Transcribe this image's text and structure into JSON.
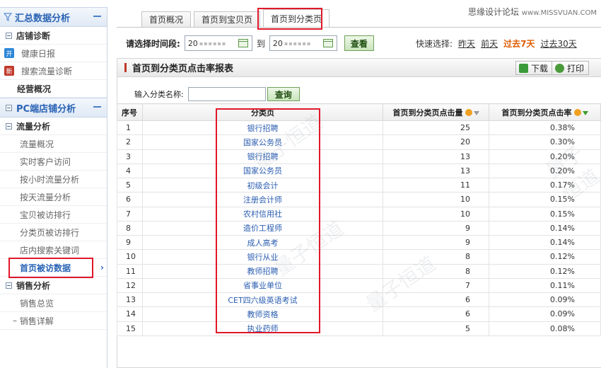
{
  "site_watermark": {
    "cn": "思缘设计论坛",
    "en": "www.MISSVUAN.COM"
  },
  "sidebar": {
    "sections": [
      {
        "title": "汇总数据分析"
      },
      {
        "title": "PC端店铺分析"
      }
    ],
    "summary_groups": [
      {
        "label": "店铺诊断",
        "items": [
          {
            "label": "健康日报",
            "badge": "开",
            "badge_color": "#2d86d8"
          },
          {
            "label": "搜索流量诊断",
            "badge": "新",
            "badge_color": "#c0392b"
          }
        ]
      },
      {
        "label": "经营概况"
      }
    ],
    "pc_groups": [
      {
        "label": "流量分析",
        "items": [
          {
            "label": "流量概况"
          },
          {
            "label": "实时客户访问"
          },
          {
            "label": "按小时流量分析"
          },
          {
            "label": "按天流量分析"
          },
          {
            "label": "宝贝被访排行"
          },
          {
            "label": "分类页被访排行"
          },
          {
            "label": "店内搜索关键词"
          },
          {
            "label": "首页被访数据",
            "active": true
          }
        ]
      },
      {
        "label": "销售分析",
        "items": [
          {
            "label": "销售总览"
          },
          {
            "label": "销售详解"
          }
        ]
      }
    ]
  },
  "tabs": [
    {
      "label": "首页概况"
    },
    {
      "label": "首页到宝贝页"
    },
    {
      "label": "首页到分类页",
      "active": true
    }
  ],
  "date_filter": {
    "label": "请选择时间段:",
    "start_prefix": "20",
    "end_prefix": "20",
    "to_label": "到",
    "query_button": "查看",
    "quick_label": "快速选择:",
    "quick_options": [
      {
        "label": "昨天"
      },
      {
        "label": "前天"
      },
      {
        "label": "过去7天",
        "current": true
      },
      {
        "label": "过去30天"
      }
    ]
  },
  "report": {
    "title": "首页到分类页点击率报表",
    "download_label": "下载",
    "print_label": "打印",
    "search_label": "输入分类名称:",
    "search_button": "查询",
    "columns": [
      "序号",
      "分类页",
      "首页到分类页点击量",
      "首页到分类页点击率"
    ],
    "rows": [
      {
        "no": "1",
        "name": "银行招聘",
        "clicks": "25",
        "rate": "0.38%"
      },
      {
        "no": "2",
        "name": "国家公务员",
        "clicks": "20",
        "rate": "0.30%"
      },
      {
        "no": "3",
        "name": "银行招聘",
        "clicks": "13",
        "rate": "0.20%"
      },
      {
        "no": "4",
        "name": "国家公务员",
        "clicks": "13",
        "rate": "0.20%"
      },
      {
        "no": "5",
        "name": "初级会计",
        "clicks": "11",
        "rate": "0.17%"
      },
      {
        "no": "6",
        "name": "注册会计师",
        "clicks": "10",
        "rate": "0.15%"
      },
      {
        "no": "7",
        "name": "农村信用社",
        "clicks": "10",
        "rate": "0.15%"
      },
      {
        "no": "8",
        "name": "造价工程师",
        "clicks": "9",
        "rate": "0.14%"
      },
      {
        "no": "9",
        "name": "成人高考",
        "clicks": "9",
        "rate": "0.14%"
      },
      {
        "no": "10",
        "name": "银行从业",
        "clicks": "8",
        "rate": "0.12%"
      },
      {
        "no": "11",
        "name": "教师招聘",
        "clicks": "8",
        "rate": "0.12%"
      },
      {
        "no": "12",
        "name": "省事业单位",
        "clicks": "7",
        "rate": "0.11%"
      },
      {
        "no": "13",
        "name": "CET四六级英语考试",
        "clicks": "6",
        "rate": "0.09%"
      },
      {
        "no": "14",
        "name": "教师资格",
        "clicks": "6",
        "rate": "0.09%"
      },
      {
        "no": "15",
        "name": "执业药师",
        "clicks": "5",
        "rate": "0.08%"
      }
    ]
  }
}
